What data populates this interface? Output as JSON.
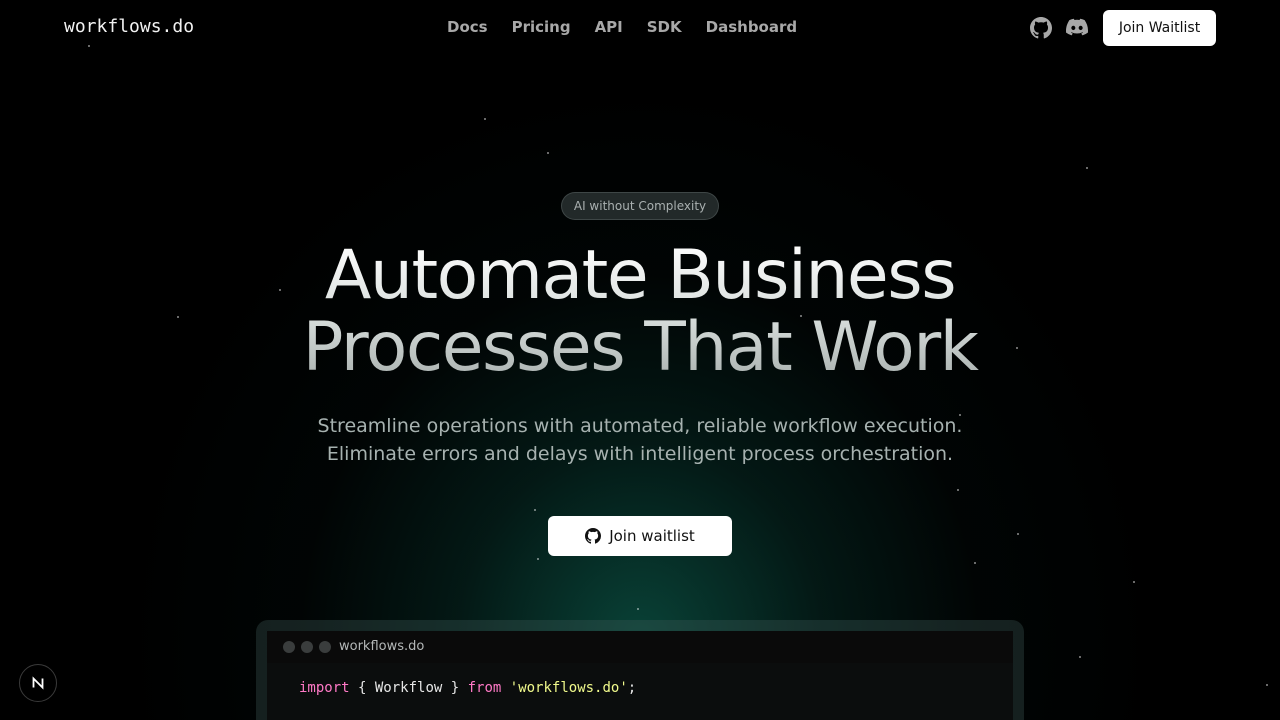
{
  "header": {
    "logo": "workflows.do",
    "nav": [
      "Docs",
      "Pricing",
      "API",
      "SDK",
      "Dashboard"
    ],
    "icons": [
      "github-icon",
      "discord-icon"
    ],
    "join_label": "Join Waitlist"
  },
  "hero": {
    "badge": "AI without Complexity",
    "headline_line1": "Automate Business",
    "headline_line2": "Processes That Work",
    "sub_line1": "Streamline operations with automated, reliable workflow execution.",
    "sub_line2": "Eliminate errors and delays with intelligent process orchestration.",
    "cta_label": "Join waitlist"
  },
  "code_window": {
    "title": "workflows.do",
    "line1": {
      "kw_import": "import",
      "braces_open": " { ",
      "ident": "Workflow",
      "braces_close": " } ",
      "kw_from": "from",
      "space": " ",
      "module": "'workflows.do'",
      "semicolon": ";"
    }
  },
  "colors": {
    "accent_glow": "#107864",
    "keyword": "#ff79c6",
    "string": "#f1fa8c"
  },
  "dev_badge_icon": "nextjs-icon"
}
